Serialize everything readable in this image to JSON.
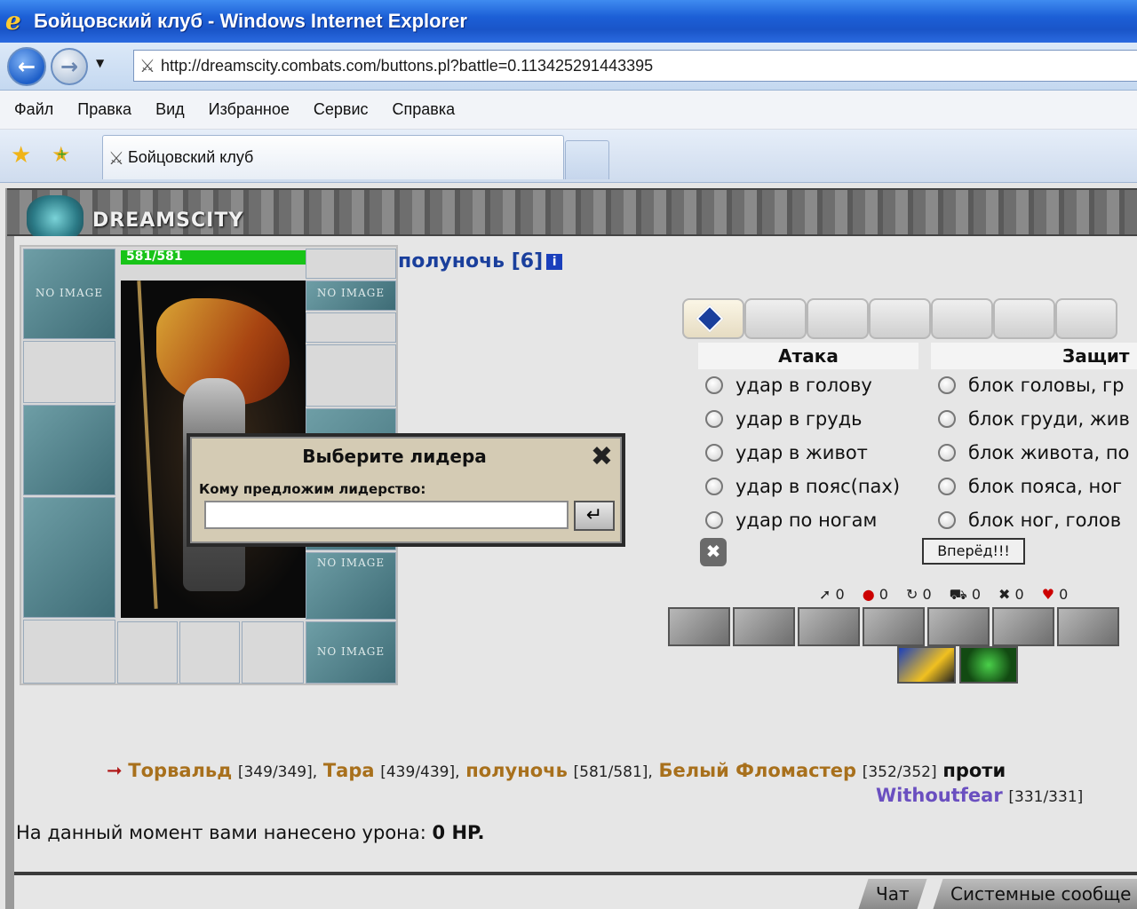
{
  "window": {
    "title": "Бойцовский клуб - Windows Internet Explorer"
  },
  "address": {
    "url": "http://dreamscity.combats.com/buttons.pl?battle=0.113425291443395"
  },
  "menu": [
    "Файл",
    "Правка",
    "Вид",
    "Избранное",
    "Сервис",
    "Справка"
  ],
  "tab": {
    "label": "Бойцовский клуб"
  },
  "site": {
    "logo": "DREAMSCITY"
  },
  "character": {
    "hp": "581/581",
    "name": "полуночь [6]",
    "info": "i",
    "no_image": "NO IMAGE"
  },
  "combat": {
    "attack_header": "Атака",
    "defense_header": "Защит",
    "attacks": [
      "удар в голову",
      "удар в грудь",
      "удар в живот",
      "удар в пояс(пах)",
      "удар по ногам"
    ],
    "blocks": [
      "блок головы, гр",
      "блок груди, жив",
      "блок живота, по",
      "блок пояса, ног",
      "блок ног, голов"
    ],
    "forward_button": "Вперёд!!!",
    "stats": [
      "0",
      "0",
      "0",
      "0",
      "0",
      "0"
    ]
  },
  "participants": {
    "allies": [
      {
        "name": "Торвальд",
        "hp": "[349/349],"
      },
      {
        "name": "Тара",
        "hp": "[439/439],"
      },
      {
        "name": "полуночь",
        "hp": "[581/581],"
      },
      {
        "name": "Белый Фломастер",
        "hp": "[352/352]"
      }
    ],
    "against": "проти",
    "enemy": {
      "name": "Withoutfear",
      "hp": "[331/331]"
    }
  },
  "damage": {
    "prefix": "На данный момент вами нанесено урона: ",
    "value": "0 HP."
  },
  "bottom_tabs": [
    "Чат",
    "Системные сообще"
  ],
  "modal": {
    "title": "Выберите лидера",
    "label": "Кому предложим лидерство:",
    "input_value": ""
  }
}
